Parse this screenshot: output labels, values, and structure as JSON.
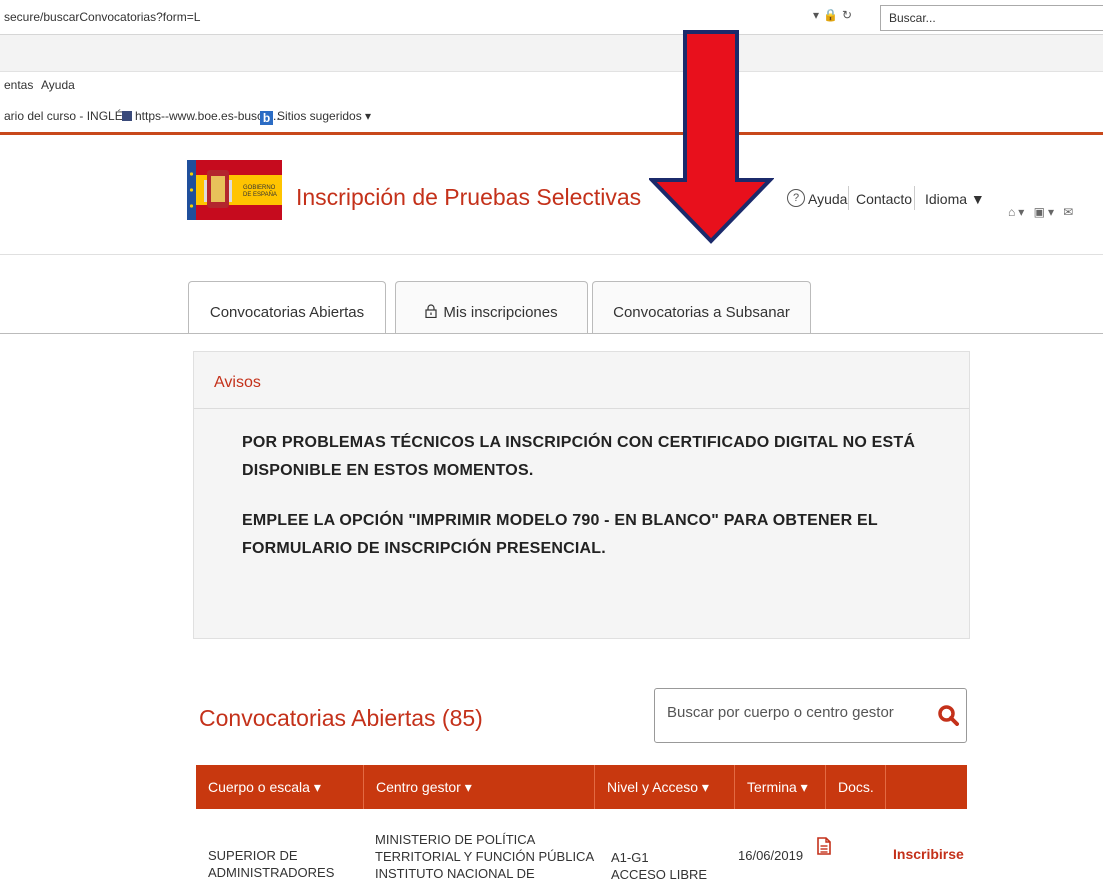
{
  "browser": {
    "url": "secure/buscarConvocatorias?form=L",
    "search_placeholder": "Buscar...",
    "menu": [
      "entas",
      "Ayuda"
    ],
    "favorites": [
      {
        "label": "ario del curso - INGLÉ..."
      },
      {
        "label": "https--www.boe.es-busca..."
      },
      {
        "label": "Sitios sugeridos ▾"
      }
    ]
  },
  "header": {
    "logo_text": [
      "GOBIERNO",
      "DE ESPAÑA"
    ],
    "title": "Inscripción de Pruebas Selectivas",
    "help": "Ayuda",
    "help_icon": "?",
    "contact": "Contacto",
    "language": "Idioma ▼"
  },
  "tabs": [
    {
      "label": "Convocatorias Abiertas",
      "active": true
    },
    {
      "label": "Mis inscripciones",
      "icon": "lock-icon"
    },
    {
      "label": "Convocatorias a Subsanar"
    }
  ],
  "avisos": {
    "title": "Avisos",
    "notices": [
      "POR PROBLEMAS TÉCNICOS LA INSCRIPCIÓN CON CERTIFICADO DIGITAL NO ESTÁ DISPONIBLE EN ESTOS MOMENTOS.",
      "EMPLEE LA OPCIÓN \"IMPRIMIR MODELO 790 - EN BLANCO\" PARA OBTENER EL FORMULARIO DE INSCRIPCIÓN PRESENCIAL."
    ]
  },
  "listing": {
    "title": "Convocatorias Abiertas (85)",
    "search_placeholder": "Buscar por cuerpo o centro gestor",
    "columns": [
      "Cuerpo o escala ▾",
      "Centro gestor ▾",
      "Nivel y Acceso ▾",
      "Termina ▾",
      "Docs.",
      ""
    ],
    "rows": [
      {
        "cuerpo": [
          "SUPERIOR DE",
          "ADMINISTRADORES"
        ],
        "centro": [
          "MINISTERIO DE POLÍTICA",
          "TERRITORIAL Y FUNCIÓN PÚBLICA",
          "INSTITUTO NACIONAL DE"
        ],
        "nivel": [
          "A1-G1",
          "ACCESO LIBRE"
        ],
        "termina": "16/06/2019",
        "action": "Inscribirse"
      }
    ]
  },
  "colors": {
    "accent": "#c4311a",
    "table_header": "#c8380f",
    "arrow": "#e8101c",
    "arrow_outline": "#1b2a6b"
  }
}
